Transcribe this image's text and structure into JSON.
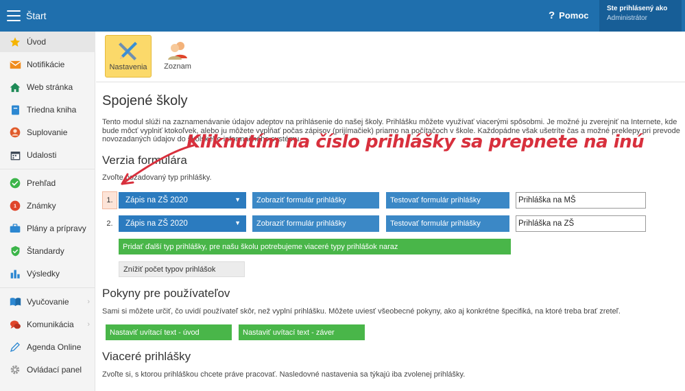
{
  "topbar": {
    "title": "Štart",
    "help_label": "Pomoc",
    "help_glyph": "?",
    "user_line1": "Ste prihlásený ako",
    "user_line2": "Administrátor"
  },
  "sidebar": {
    "items": [
      {
        "label": "Úvod",
        "icon": "star-icon"
      },
      {
        "label": "Notifikácie",
        "icon": "envelope-icon"
      },
      {
        "label": "Web stránka",
        "icon": "home-icon"
      },
      {
        "label": "Triedna kniha",
        "icon": "book-icon"
      },
      {
        "label": "Suplovanie",
        "icon": "person-icon"
      },
      {
        "label": "Udalosti",
        "icon": "calendar-icon"
      },
      {
        "label": "Prehľad",
        "icon": "check-circle-icon"
      },
      {
        "label": "Známky",
        "icon": "grade-icon"
      },
      {
        "label": "Plány a prípravy",
        "icon": "briefcase-icon"
      },
      {
        "label": "Štandardy",
        "icon": "shield-check-icon"
      },
      {
        "label": "Výsledky",
        "icon": "bar-chart-icon"
      },
      {
        "label": "Vyučovanie",
        "icon": "open-book-icon"
      },
      {
        "label": "Komunikácia",
        "icon": "chat-icon"
      },
      {
        "label": "Agenda Online",
        "icon": "pen-icon"
      },
      {
        "label": "Ovládací panel",
        "icon": "gear-icon"
      }
    ],
    "chevron": "›"
  },
  "toolbar": {
    "settings_label": "Nastavenia",
    "list_label": "Zoznam"
  },
  "main": {
    "title": "Spojené školy",
    "intro_line1": "Tento modul slúži na zaznamenávanie údajov adeptov na prihlásenie do našej školy. Prihlášku môžete využívať viacerými spôsobmi. Je možné ju zverejniť na Internete, kde",
    "intro_line2": "bude môcť vyplniť ktokoľvek, alebo ju môžete vypĺňať počas zápisov (prijímačiek) priamo na počítačoch v škole. Každopádne však ušetríte čas a možné preklepy pri prevode",
    "intro_line3": "novozadaných údajov do školského informačného systému.",
    "version_heading": "Verzia formulára",
    "version_desc": "Zvoľte požadovaný typ prihlášky.",
    "forms": [
      {
        "num": "1.",
        "type": "Zápis na ZŠ 2020",
        "show_label": "Zobraziť formulár prihlášky",
        "test_label": "Testovať formulár prihlášky",
        "name": "Prihláška na MŠ"
      },
      {
        "num": "2.",
        "type": "Zápis na ZŠ 2020",
        "show_label": "Zobraziť formulár prihlášky",
        "test_label": "Testovať formulár prihlášky",
        "name": "Prihláška na ZŠ"
      }
    ],
    "caret": "▼",
    "add_type_label": "Pridať ďalší typ prihlášky, pre našu školu potrebujeme viaceré typy prihlášok naraz",
    "reduce_label": "Znížiť počet typov prihlášok",
    "instructions_heading": "Pokyny pre používateľov",
    "instructions_desc": "Sami si môžete určiť, čo uvidí používateľ skôr, než vyplní prihlášku. Môžete uviesť všeobecné pokyny, ako aj konkrétne špecifiká, na ktoré treba brať zreteľ.",
    "welcome_intro_label": "Nastaviť uvítací text - úvod",
    "welcome_end_label": "Nastaviť uvítací text - záver",
    "multi_heading": "Viaceré prihlášky",
    "multi_desc": "Zvoľte si, s ktorou prihláškou chcete práve pracovať. Nasledovné nastavenia sa týkajú iba zvolenej prihlášky."
  },
  "annotation": {
    "text": "Kliknutím na číslo prihlášky sa prepnete na inú"
  },
  "colors": {
    "topbar": "#1f6fad",
    "primary_button": "#2b7bbf",
    "success_button": "#49b649",
    "highlight": "#fbd96a",
    "annotation": "#d8303d"
  }
}
